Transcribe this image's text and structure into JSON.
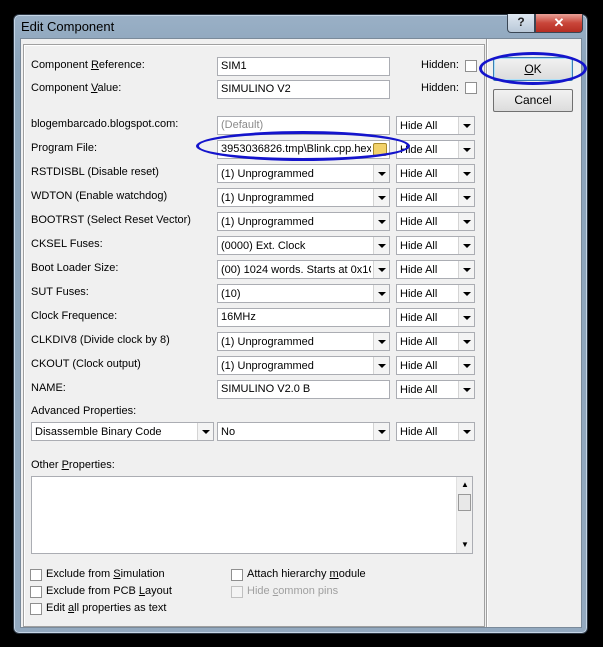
{
  "window": {
    "title": "Edit Component",
    "help_glyph": "?",
    "close_glyph": "✕"
  },
  "component_reference": {
    "label_pre": "Component ",
    "label_u": "R",
    "label_post": "eference:",
    "value": "SIM1",
    "hidden_label": "Hidden:"
  },
  "component_value": {
    "label_pre": "Component ",
    "label_u": "V",
    "label_post": "alue:",
    "value": "SIMULINO V2",
    "hidden_label": "Hidden:"
  },
  "buttons": {
    "ok_u": "O",
    "ok_post": "K",
    "cancel": "Cancel"
  },
  "properties": [
    {
      "label": "blogembarcado.blogspot.com:",
      "value": "(Default)",
      "kind": "text-disabled",
      "vis": "Hide All"
    },
    {
      "label": "Program File:",
      "value": "3953036826.tmp\\Blink.cpp.hex",
      "kind": "file",
      "vis": "Hide All"
    },
    {
      "label": "RSTDISBL (Disable reset)",
      "value": "(1) Unprogrammed",
      "kind": "combo",
      "vis": "Hide All"
    },
    {
      "label": "WDTON (Enable watchdog)",
      "value": "(1) Unprogrammed",
      "kind": "combo",
      "vis": "Hide All"
    },
    {
      "label": "BOOTRST (Select Reset Vector)",
      "value": "(1) Unprogrammed",
      "kind": "combo",
      "vis": "Hide All"
    },
    {
      "label": "CKSEL Fuses:",
      "value": "(0000) Ext. Clock",
      "kind": "combo",
      "vis": "Hide All"
    },
    {
      "label": "Boot Loader Size:",
      "value": "(00) 1024 words. Starts at 0x1C(",
      "kind": "combo",
      "vis": "Hide All"
    },
    {
      "label": "SUT Fuses:",
      "value": "(10)",
      "kind": "combo",
      "vis": "Hide All"
    },
    {
      "label": "Clock Frequence:",
      "value": "16MHz",
      "kind": "text",
      "vis": "Hide All"
    },
    {
      "label": "CLKDIV8 (Divide clock by 8)",
      "value": "(1) Unprogrammed",
      "kind": "combo",
      "vis": "Hide All"
    },
    {
      "label": "CKOUT (Clock output)",
      "value": "(1) Unprogrammed",
      "kind": "combo",
      "vis": "Hide All"
    },
    {
      "label": "NAME:",
      "value": "SIMULINO V2.0 B",
      "kind": "text",
      "vis": "Hide All"
    }
  ],
  "advanced": {
    "label": "Advanced Properties:",
    "property": "Disassemble Binary Code",
    "value": "No",
    "vis": "Hide All"
  },
  "other": {
    "label_pre": "Other ",
    "label_u": "P",
    "label_post": "roperties:",
    "text": ""
  },
  "checkboxes": {
    "exclude_sim": {
      "pre": "Exclude from ",
      "u": "S",
      "post": "imulation"
    },
    "exclude_pcb": {
      "pre": "Exclude from PCB ",
      "u": "L",
      "post": "ayout"
    },
    "edit_all": {
      "pre": "Edit ",
      "u": "a",
      "post": "ll properties as text"
    },
    "attach_hier": {
      "pre": "Attach hierarchy ",
      "u": "m",
      "post": "odule"
    },
    "hide_common": {
      "pre": "Hide ",
      "u": "c",
      "post": "ommon pins"
    }
  }
}
